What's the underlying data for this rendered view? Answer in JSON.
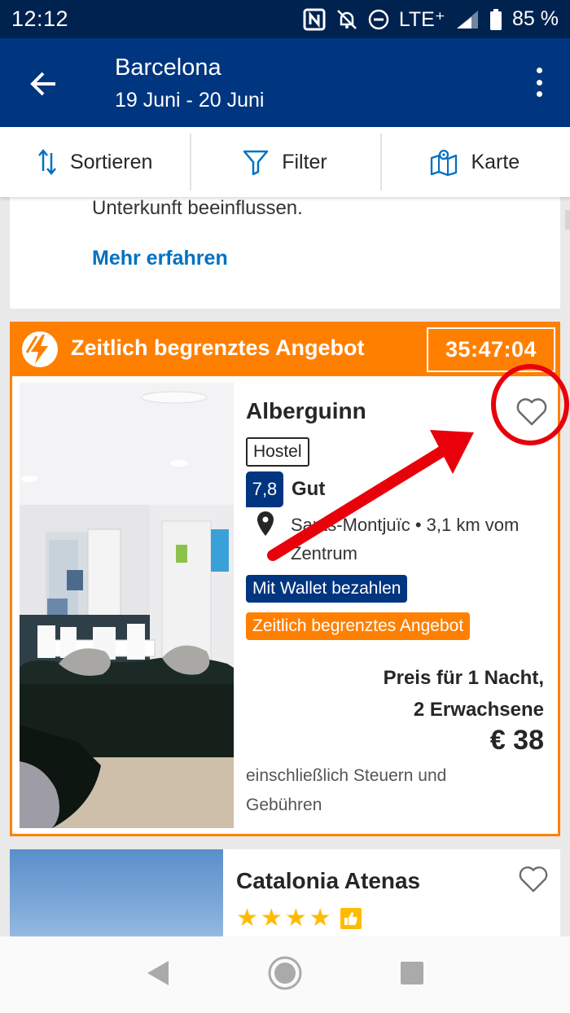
{
  "status_bar": {
    "time": "12:12",
    "network": "LTE⁺",
    "battery": "85 %"
  },
  "header": {
    "title": "Barcelona",
    "dates": "19 Juni - 20 Juni"
  },
  "toolbar": {
    "sort_label": "Sortieren",
    "filter_label": "Filter",
    "map_label": "Karte"
  },
  "info_card": {
    "text": "Unterkunft beeinflussen.",
    "link": "Mehr erfahren"
  },
  "deal_card": {
    "banner_label": "Zeitlich begrenztes Angebot",
    "countdown": "35:47:04",
    "hotel_name": "Alberguinn",
    "property_type": "Hostel",
    "review_score": "7,8",
    "review_word": "Gut",
    "location": "Sants-Montjuïc • 3,1 km vom Zentrum",
    "badge_wallet": "Mit Wallet bezahlen",
    "badge_deal": "Zeitlich begrenztes Angebot",
    "price_label_line1": "Preis für 1 Nacht,",
    "price_label_line2": "2 Erwachsene",
    "price": "€ 38",
    "tax_note": "einschließlich Steuern und Gebühren"
  },
  "second_card": {
    "hotel_name": "Catalonia Atenas",
    "stars": 4
  },
  "colors": {
    "brand_blue": "#003580",
    "status_bar": "#00224f",
    "deal_orange": "#ff8000",
    "link_blue": "#0071c2",
    "annotation_red": "#e8000b",
    "star_yellow": "#febb02"
  }
}
